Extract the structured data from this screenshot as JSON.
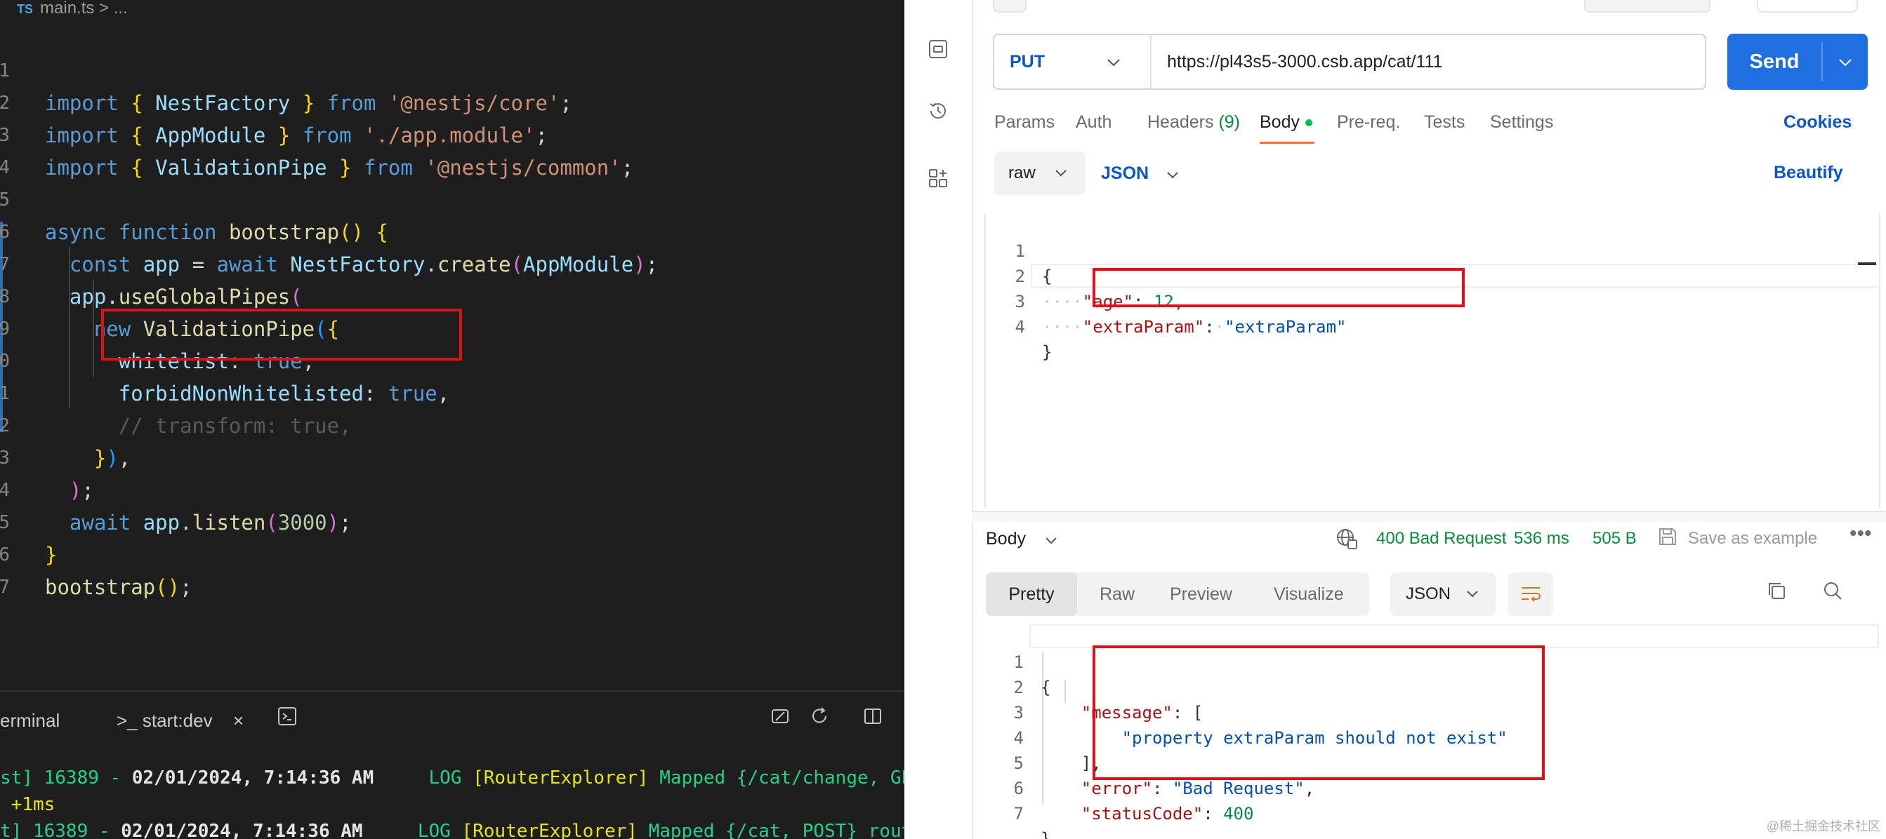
{
  "editor": {
    "breadcrumb": {
      "lang": "TS",
      "file": "main.ts",
      "sep": ">",
      "rest": "..."
    },
    "line_numbers": [
      "1",
      "2",
      "3",
      "4",
      "5",
      "6",
      "7",
      "8",
      "9",
      "0",
      "1",
      "2",
      "3",
      "4",
      "5",
      "6",
      "7"
    ],
    "tokens": {
      "import": "import",
      "from": "from",
      "nest_factory": "NestFactory",
      "app_module": "AppModule",
      "validation_pipe": "ValidationPipe",
      "str_core": "'@nestjs/core'",
      "str_app_module": "'./app.module'",
      "str_common": "'@nestjs/common'",
      "async": "async",
      "function": "function",
      "bootstrap": "bootstrap",
      "const": "const",
      "app": "app",
      "await": "await",
      "create": "create",
      "use_global_pipes": "useGlobalPipes",
      "new": "new",
      "whitelist": "whitelist",
      "true": "true",
      "forbid": "forbidNonWhitelisted",
      "comment": "// transform: true,",
      "listen": "listen",
      "port": "3000"
    }
  },
  "terminal": {
    "tab_terminal": "erminal",
    "tab_task": ">_ start:dev",
    "close": "×",
    "lines": [
      {
        "pid": "st] 16389",
        "dash": " - ",
        "date": "02/01/2024, 7:14:36 AM",
        "log": "     LOG ",
        "ctx": "[RouterExplorer]",
        "msg": " Mapped {/cat/change, GET}"
      },
      {
        "ms": " +1ms"
      },
      {
        "pid": "t] 16389",
        "dash": " - ",
        "date": "02/01/2024, 7:14:36 AM",
        "log": "     LOG ",
        "ctx": "[RouterExplorer]",
        "msg": " Mapped {/cat, POST} route"
      }
    ]
  },
  "client": {
    "method": "PUT",
    "url": "https://pl43s5-3000.csb.app/cat/111",
    "send": "Send",
    "tabs": {
      "params": "Params",
      "auth": "Auth",
      "headers": "Headers",
      "headers_count": "(9)",
      "body": "Body",
      "prereq": "Pre-req.",
      "tests": "Tests",
      "settings": "Settings"
    },
    "cookies": "Cookies",
    "body_mode": "raw",
    "body_format": "JSON",
    "beautify": "Beautify",
    "request_lines": [
      "1",
      "2",
      "3",
      "4"
    ],
    "request_json": {
      "open": "{",
      "age_key": "\"age\"",
      "age_val": "12",
      "extra_key": "\"extraParam\"",
      "extra_val": "\"extraParam\"",
      "close": "}"
    },
    "response": {
      "label": "Body",
      "status": "400 Bad Request",
      "time": "536 ms",
      "size": "505 B",
      "save": "Save as example",
      "more": "•••",
      "tabs": {
        "pretty": "Pretty",
        "raw": "Raw",
        "preview": "Preview",
        "visualize": "Visualize"
      },
      "format": "JSON",
      "lines": [
        "1",
        "2",
        "3",
        "4",
        "5",
        "6",
        "7"
      ],
      "json": {
        "open": "{",
        "message_key": "\"message\"",
        "array_open": "[",
        "message_val": "\"property extraParam should not exist\"",
        "array_close": "],",
        "error_key": "\"error\"",
        "error_val": "\"Bad Request\"",
        "status_key": "\"statusCode\"",
        "status_val": "400",
        "close": "}"
      }
    },
    "watermark": "@稀土掘金技术社区"
  },
  "colors": {
    "accent": "#1f6fe0",
    "highlight": "#e0101a",
    "status_ok_text": "#0a8a3a",
    "active_tab_underline": "#ff6c37"
  }
}
